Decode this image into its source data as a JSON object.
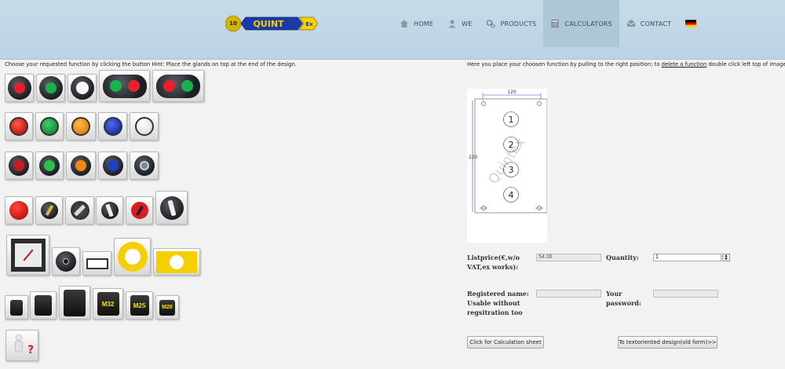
{
  "header": {
    "logo_text": "QUINT",
    "logo_ex": "Ex",
    "logo_anniversary": "10",
    "nav": [
      {
        "label": "HOME",
        "icon": "home-icon"
      },
      {
        "label": "WE",
        "icon": "person-icon"
      },
      {
        "label": "PRODUCTS",
        "icon": "gears-icon"
      },
      {
        "label": "CALCULATORS",
        "icon": "calculator-icon",
        "active": true
      },
      {
        "label": "CONTACT",
        "icon": "envelope-icon"
      }
    ],
    "language_flag": "german-flag-icon"
  },
  "left": {
    "hint": "Choose your requested function by clicking the button     Hint: Place the glands on top at the end of the design."
  },
  "right": {
    "hint_before": "Here you place your choosen function by pulling to the right position; to ",
    "hint_link": "delete a function",
    "hint_after": " double click left top of image",
    "drawing": {
      "width_label": "120",
      "height_label": "220",
      "positions": [
        "1",
        "2",
        "3",
        "4"
      ],
      "watermark": "QuintEx"
    },
    "price_label": "Listprice(€,w/o VAT,ex works):",
    "price_value": "54.06",
    "quantity_label": "Quantity:",
    "quantity_value": "1",
    "registered_label": "Registered name: Usable without regsitration too",
    "password_label": "Your password:",
    "calc_button": "Click for Calculation sheet",
    "text_button": "To textoriented design(old form)>>"
  },
  "colors": {
    "header_bg": "#c7dbe8",
    "lamp_red": "#e8202a",
    "lamp_green": "#19b34a",
    "lamp_orange": "#f08a10",
    "lamp_blue": "#1c3fc8",
    "lamp_white": "#f4f4ec",
    "yellow": "#f5cf00"
  }
}
